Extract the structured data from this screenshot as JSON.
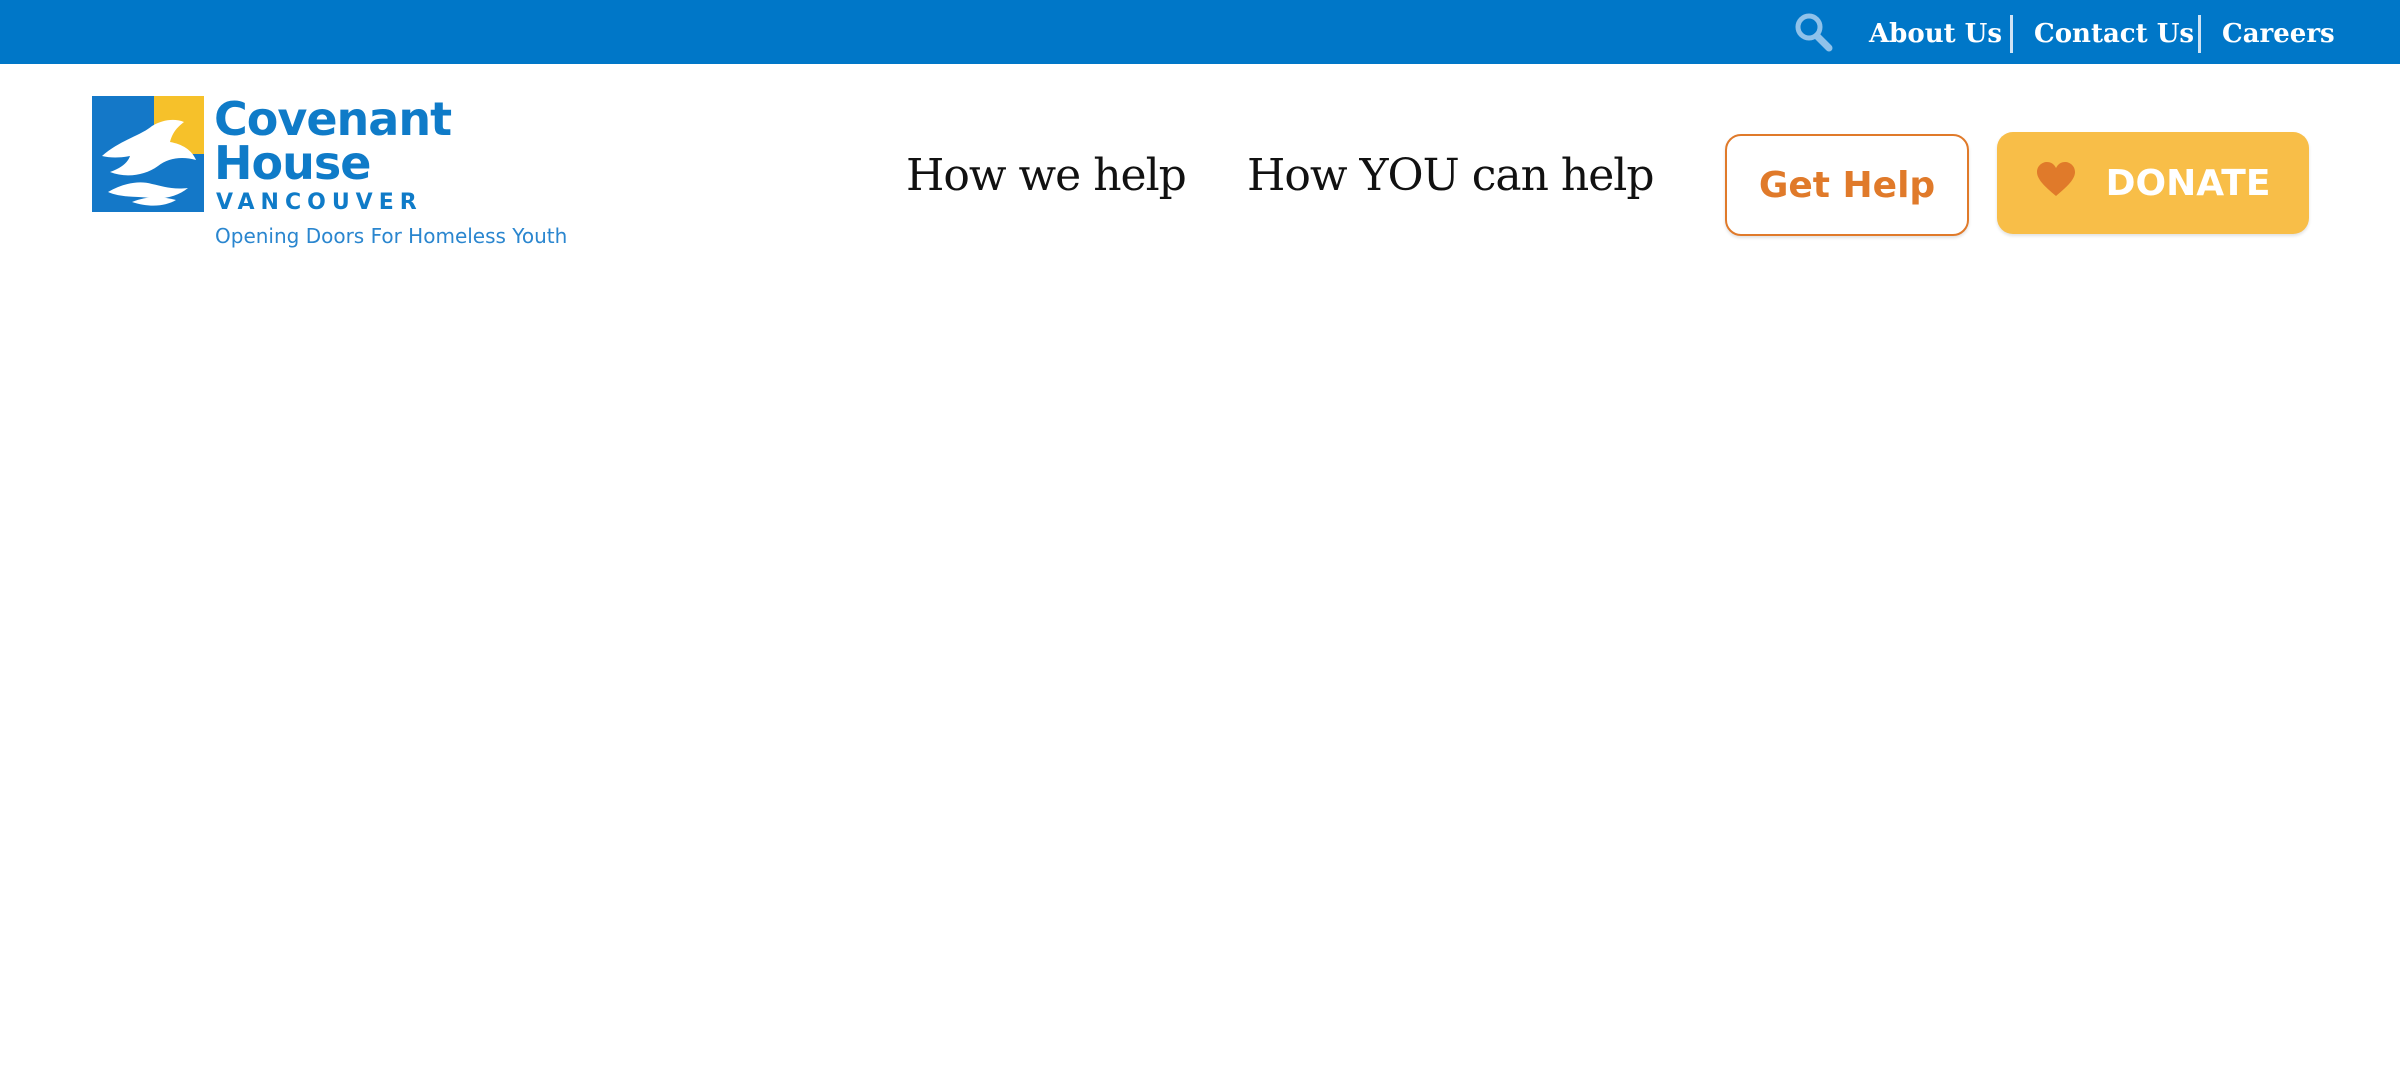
{
  "utility_nav": {
    "search_icon": "search-icon",
    "links": [
      "About Us",
      "Contact Us",
      "Careers"
    ]
  },
  "logo": {
    "name_line1": "Covenant",
    "name_line2": "House",
    "city": "VANCOUVER",
    "tagline": "Opening Doors For Homeless Youth"
  },
  "main_nav": {
    "items": [
      "How we help",
      "How YOU can help"
    ]
  },
  "actions": {
    "get_help": "Get Help",
    "donate": "DONATE",
    "donate_icon": "heart-icon"
  },
  "colors": {
    "topbar": "#0077c8",
    "brand_blue": "#0f7bc8",
    "brand_orange": "#e07a2a",
    "donate_yellow": "#f8be48"
  }
}
